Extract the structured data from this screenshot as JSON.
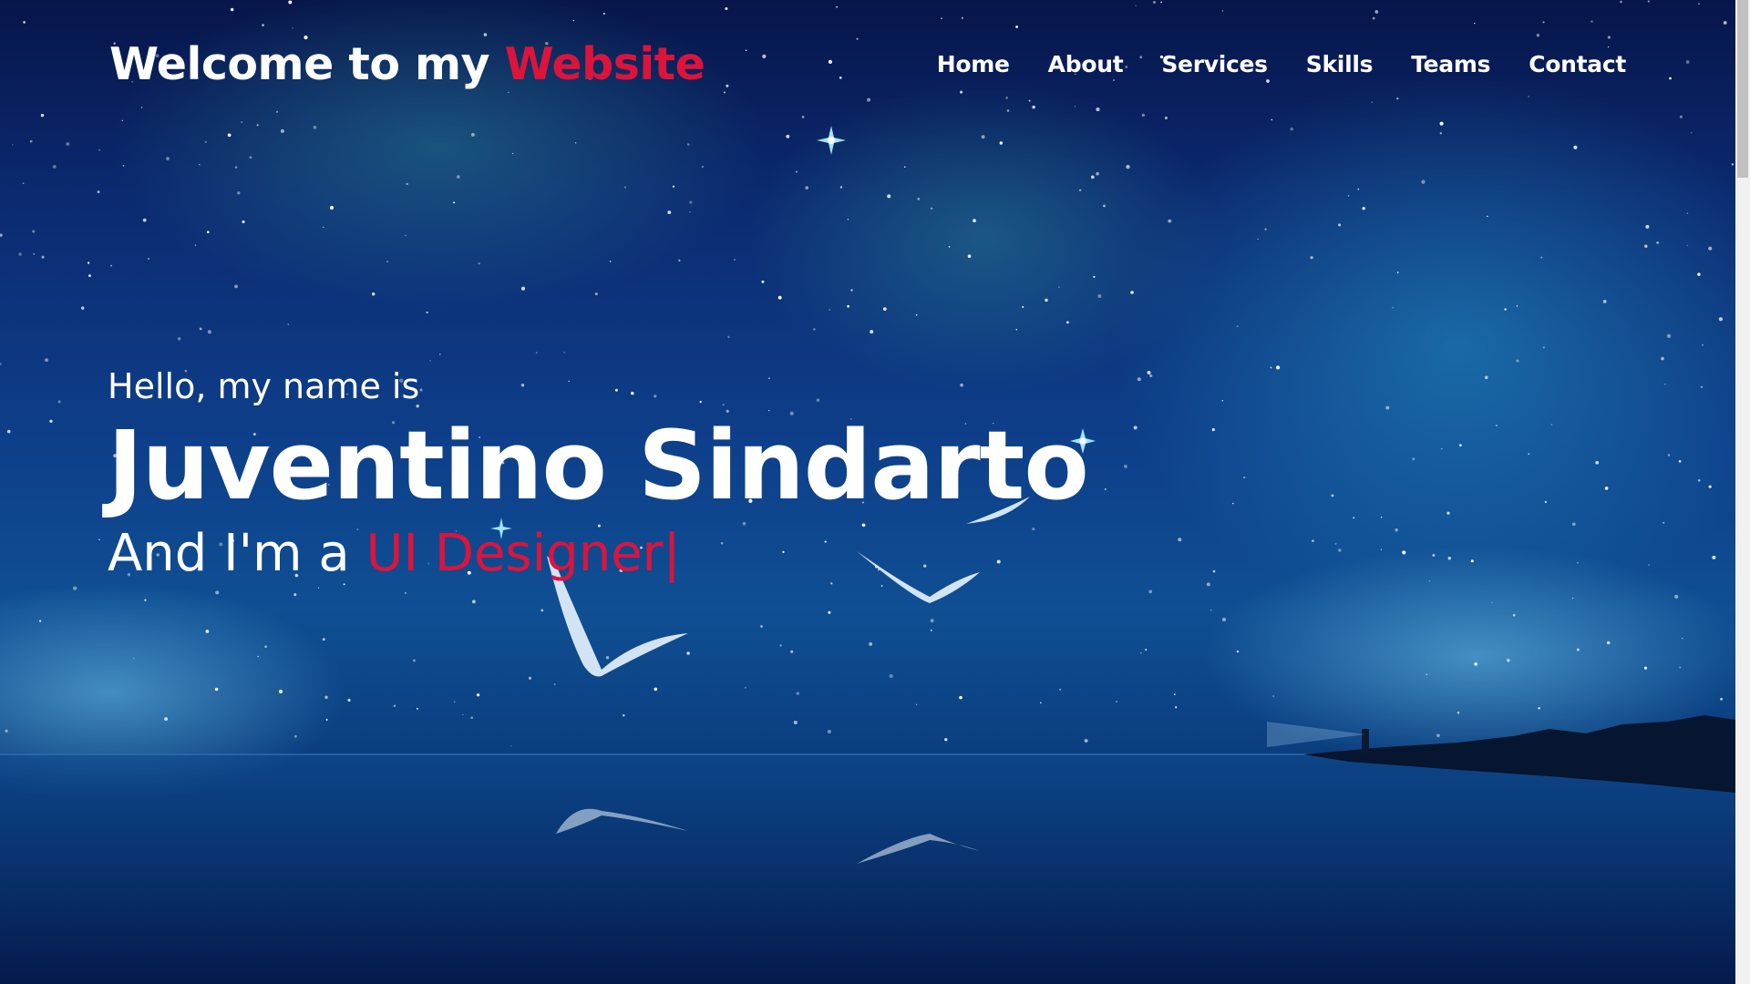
{
  "header": {
    "logo_prefix": "Welcome to my ",
    "logo_accent": "Website"
  },
  "nav": {
    "items": [
      {
        "label": "Home"
      },
      {
        "label": "About"
      },
      {
        "label": "Services"
      },
      {
        "label": "Skills"
      },
      {
        "label": "Teams"
      },
      {
        "label": "Contact"
      }
    ]
  },
  "hero": {
    "greeting": "Hello, my name is",
    "name": "Juventino Sindarto",
    "role_prefix": "And I'm a ",
    "role_accent": "UI Designer|"
  },
  "colors": {
    "accent": "#dc143c",
    "text": "#ffffff",
    "sky": "#0b2f78"
  }
}
